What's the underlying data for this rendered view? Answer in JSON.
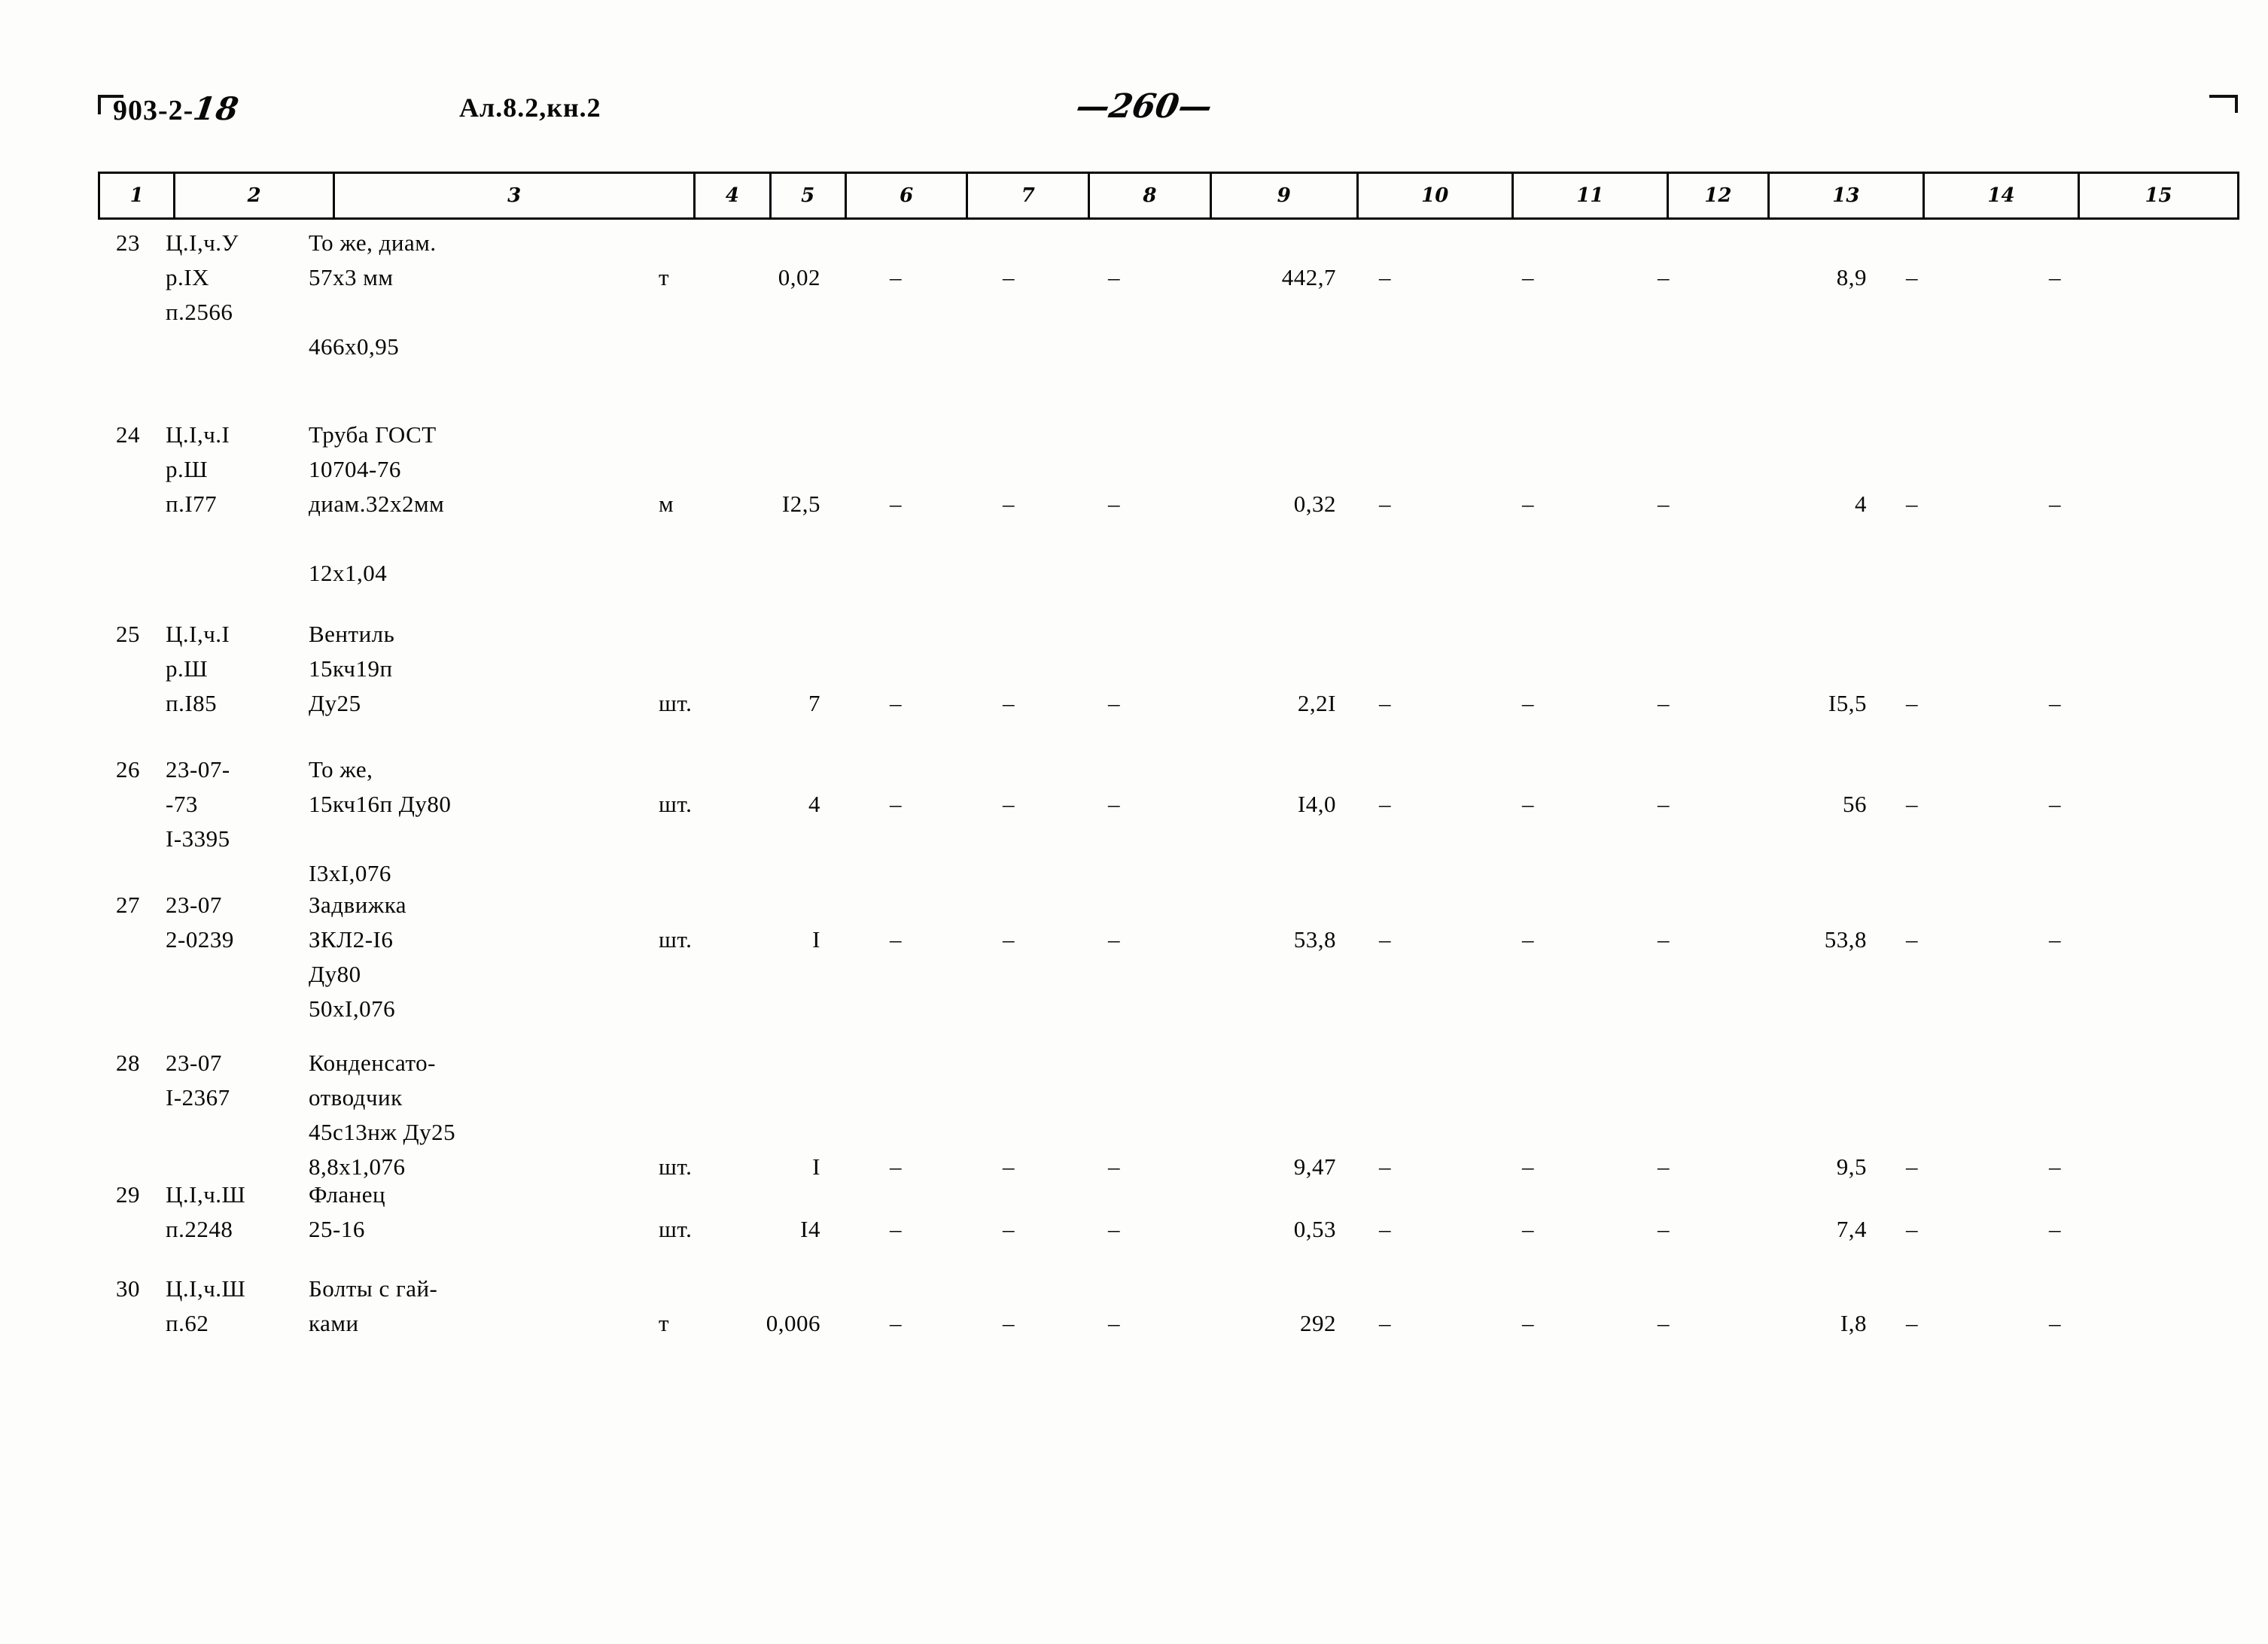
{
  "header": {
    "doc_code": "903-2-",
    "doc_code_hand": "18",
    "album": "Ал.8.2,кн.2",
    "page_number": "—260—"
  },
  "table": {
    "column_headers": [
      "1",
      "2",
      "3",
      "4",
      "5",
      "6",
      "7",
      "8",
      "9",
      "10",
      "11",
      "12",
      "13",
      "14",
      "15"
    ],
    "rows": [
      {
        "num": "23",
        "code_lines": [
          "Ц.I,ч.У",
          "р.IX",
          "п.2566"
        ],
        "name_lines": [
          "То же, диам.",
          "57х3 мм",
          "",
          "466х0,95"
        ],
        "unit": "т",
        "qty": "0,02",
        "c6": "–",
        "c7": "–",
        "c8": "–",
        "c9": "442,7",
        "c10": "–",
        "c11": "–",
        "c12": "–",
        "c13": "8,9",
        "c14": "–",
        "c15": "–"
      },
      {
        "num": "24",
        "code_lines": [
          "Ц.I,ч.I",
          "р.Ш",
          "п.I77"
        ],
        "name_lines": [
          "Труба ГОСТ",
          "10704-76",
          "диам.32х2мм",
          "",
          "12х1,04"
        ],
        "unit": "м",
        "qty": "I2,5",
        "c6": "–",
        "c7": "–",
        "c8": "–",
        "c9": "0,32",
        "c10": "–",
        "c11": "–",
        "c12": "–",
        "c13": "4",
        "c14": "–",
        "c15": "–"
      },
      {
        "num": "25",
        "code_lines": [
          "Ц.I,ч.I",
          "р.Ш",
          "п.I85"
        ],
        "name_lines": [
          "Вентиль",
          "15кч19п",
          "Ду25"
        ],
        "unit": "шт.",
        "qty": "7",
        "c6": "–",
        "c7": "–",
        "c8": "–",
        "c9": "2,2I",
        "c10": "–",
        "c11": "–",
        "c12": "–",
        "c13": "I5,5",
        "c14": "–",
        "c15": "–"
      },
      {
        "num": "26",
        "code_lines": [
          "23-07-",
          "-73",
          "I-3395"
        ],
        "name_lines": [
          "То же,",
          "15кч16п Ду80",
          "",
          "I3хI,076"
        ],
        "unit": "шт.",
        "qty": "4",
        "c6": "–",
        "c7": "–",
        "c8": "–",
        "c9": "I4,0",
        "c10": "–",
        "c11": "–",
        "c12": "–",
        "c13": "56",
        "c14": "–",
        "c15": "–"
      },
      {
        "num": "27",
        "code_lines": [
          "23-07",
          "2-0239"
        ],
        "name_lines": [
          "Задвижка",
          "ЗКЛ2-I6",
          "Ду80",
          "50хI,076"
        ],
        "unit": "шт.",
        "qty": "I",
        "c6": "–",
        "c7": "–",
        "c8": "–",
        "c9": "53,8",
        "c10": "–",
        "c11": "–",
        "c12": "–",
        "c13": "53,8",
        "c14": "–",
        "c15": "–"
      },
      {
        "num": "28",
        "code_lines": [
          "23-07",
          "I-2367"
        ],
        "name_lines": [
          "Конденсато-",
          "отводчик",
          "45с13нж Ду25",
          "8,8х1,076"
        ],
        "unit": "шт.",
        "qty": "I",
        "c6": "–",
        "c7": "–",
        "c8": "–",
        "c9": "9,47",
        "c10": "–",
        "c11": "–",
        "c12": "–",
        "c13": "9,5",
        "c14": "–",
        "c15": "–"
      },
      {
        "num": "29",
        "code_lines": [
          "Ц.I,ч.Ш",
          "п.2248"
        ],
        "name_lines": [
          "Фланец",
          "25-16"
        ],
        "unit": "шт.",
        "qty": "I4",
        "c6": "–",
        "c7": "–",
        "c8": "–",
        "c9": "0,53",
        "c10": "–",
        "c11": "–",
        "c12": "–",
        "c13": "7,4",
        "c14": "–",
        "c15": "–"
      },
      {
        "num": "30",
        "code_lines": [
          "Ц.I,ч.Ш",
          "п.62"
        ],
        "name_lines": [
          "Болты с гай-",
          "ками"
        ],
        "unit": "т",
        "qty": "0,006",
        "c6": "–",
        "c7": "–",
        "c8": "–",
        "c9": "292",
        "c10": "–",
        "c11": "–",
        "c12": "–",
        "c13": "I,8",
        "c14": "–",
        "c15": "–"
      }
    ]
  }
}
